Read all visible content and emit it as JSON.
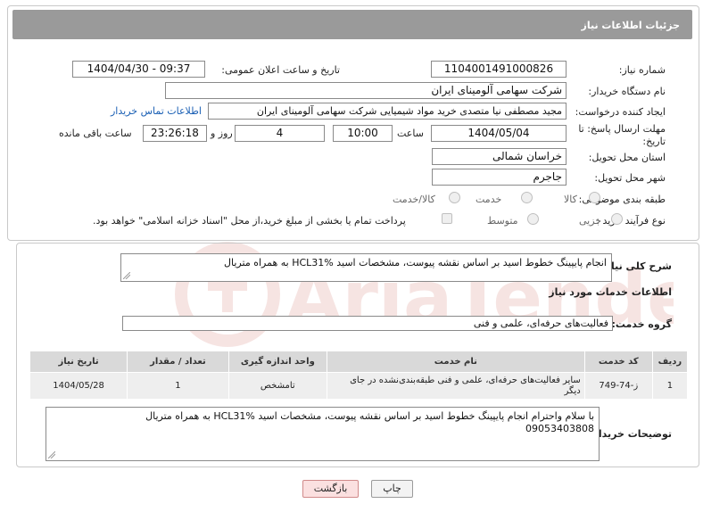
{
  "header": {
    "title": "جزئیات اطلاعات نیاز"
  },
  "need_number": {
    "label": "شماره نیاز:",
    "value": "1104001491000826"
  },
  "announce_date": {
    "label": "تاریخ و ساعت اعلان عمومی:",
    "value": "1404/04/30 - 09:37"
  },
  "buyer_org": {
    "label": "نام دستگاه خریدار:",
    "value": "شرکت سهامی آلومینای ایران"
  },
  "requester": {
    "label": "ایجاد کننده درخواست:",
    "value": "مجید مصطفی نیا متصدی خرید مواد شیمیایی شرکت سهامی آلومینای ایران",
    "contact_link": "اطلاعات تماس خریدار"
  },
  "deadline": {
    "label_line1": "مهلت ارسال پاسخ: تا",
    "label_line2": "تاریخ:",
    "date": "1404/05/04",
    "time_label": "ساعت",
    "time": "10:00",
    "days": "4",
    "days_label": "روز و",
    "remaining": "23:26:18",
    "remaining_label": "ساعت باقی مانده"
  },
  "province": {
    "label": "استان محل تحویل:",
    "value": "خراسان شمالی"
  },
  "city": {
    "label": "شهر محل تحویل:",
    "value": "جاجرم"
  },
  "category": {
    "label": "طبقه بندی موضوعی:",
    "options": [
      "کالا",
      "خدمت",
      "کالا/خدمت"
    ]
  },
  "purchase_type": {
    "label": "نوع فرآیند خرید :",
    "options": [
      "جزیی",
      "متوسط"
    ],
    "note": "پرداخت تمام یا بخشی از مبلغ خرید،از محل \"اسناد خزانه اسلامی\" خواهد بود."
  },
  "description": {
    "label": "شرح کلی نیاز:",
    "value": "انجام پایپینگ خطوط اسید بر اساس نقشه پیوست،  مشخصات اسید HCL31% به همراه متریال"
  },
  "services": {
    "title": "اطلاعات خدمات مورد نیاز",
    "group_label": "گروه خدمت:",
    "group_value": "فعالیت‌های حرفه‌ای، علمی و فنی",
    "columns": [
      "ردیف",
      "کد خدمت",
      "نام خدمت",
      "واحد اندازه گیری",
      "تعداد / مقدار",
      "تاریخ نیاز"
    ],
    "rows": [
      [
        "1",
        "ز-74-749",
        "سایر فعالیت‌های حرفه‌ای، علمی و فنی طبقه‌بندی‌نشده در جای دیگر",
        "تامشخص",
        "1",
        "1404/05/28"
      ]
    ]
  },
  "buyer_notes": {
    "label": "توضیحات خریدار:",
    "line1": "با سلام واحترام انجام پایپینگ خطوط اسید بر اساس نقشه پیوست،  مشخصات اسید HCL31% به همراه متریال",
    "line2": "09053403808"
  },
  "buttons": {
    "print": "چاپ",
    "back": "بازگشت"
  },
  "watermark": {
    "text": "AriaTender.neT"
  }
}
